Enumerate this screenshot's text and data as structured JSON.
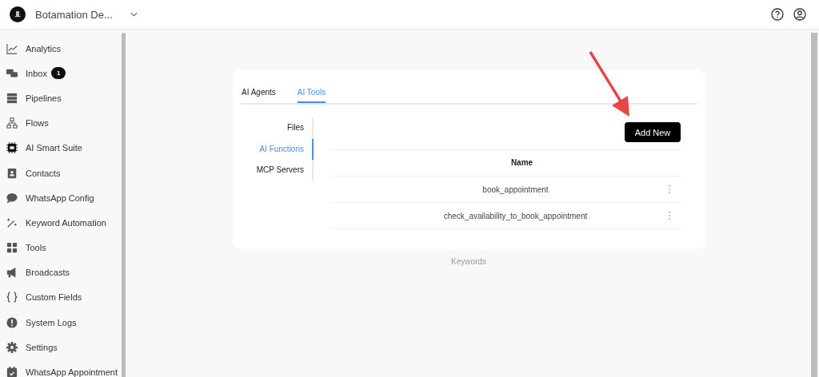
{
  "header": {
    "workspace": "Botamation De..."
  },
  "sidebar": {
    "items": [
      {
        "label": "Analytics"
      },
      {
        "label": "Inbox",
        "badge": "1"
      },
      {
        "label": "Pipelines"
      },
      {
        "label": "Flows"
      },
      {
        "label": "AI Smart Suite"
      },
      {
        "label": "Contacts"
      },
      {
        "label": "WhatsApp Config"
      },
      {
        "label": "Keyword Automation"
      },
      {
        "label": "Tools"
      },
      {
        "label": "Broadcasts"
      },
      {
        "label": "Custom Fields"
      },
      {
        "label": "System Logs"
      },
      {
        "label": "Settings"
      },
      {
        "label": "WhatsApp Appointment"
      }
    ]
  },
  "tabs": [
    {
      "label": "AI Agents",
      "selected": false
    },
    {
      "label": "AI Tools",
      "selected": true
    }
  ],
  "side_nav": [
    {
      "label": "Files",
      "selected": false
    },
    {
      "label": "AI Functions",
      "selected": true
    },
    {
      "label": "MCP Servers",
      "selected": false
    }
  ],
  "add_button": "Add New",
  "table": {
    "columns": [
      "Name"
    ],
    "rows": [
      [
        "book_appointment"
      ],
      [
        "check_availability_to_book_appointment"
      ]
    ]
  },
  "footer_link": "Keywords"
}
